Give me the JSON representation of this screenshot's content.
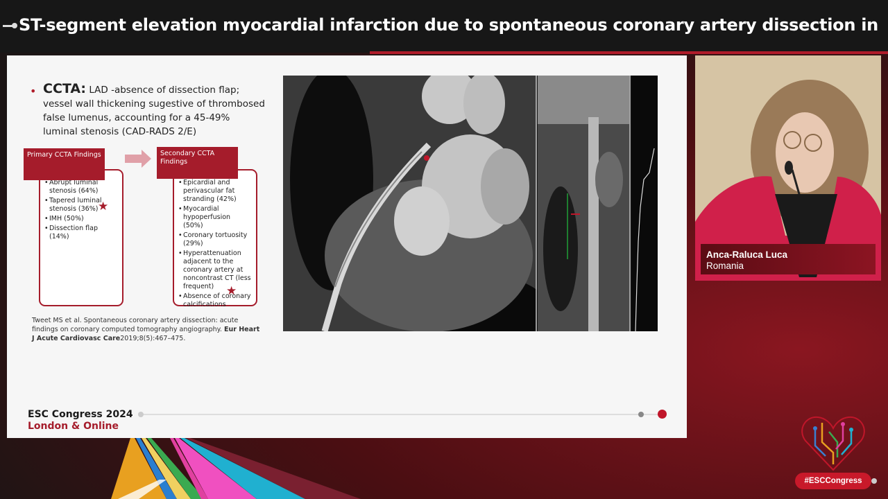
{
  "title": "ST-segment elevation myocardial infarction due to spontaneous coronary artery dissection in a you…",
  "slide": {
    "heading": "CCTA:",
    "body": "LAD -absence of dissection flap; vessel wall thickening  sugestive of thrombosed false lumenus, accounting for a 45-49% luminal stenosis (CAD-RADS 2/E)",
    "primary": {
      "header": "Primary CCTA Findings",
      "items": [
        "Abrupt luminal stenosis (64%)",
        "Tapered luminal stenosis (36%)",
        "IMH (50%)",
        "Dissection flap (14%)"
      ]
    },
    "secondary": {
      "header": "Secondary CCTA Findings",
      "items": [
        "Epicardial and perivascular fat stranding (42%)",
        "Myocardial hypoperfusion (50%)",
        "Coronary tortuosity (29%)",
        "Hyperattenuation adjacent to the coronary artery at noncontrast CT (less frequent)",
        "Absence of coronary calcifications"
      ]
    },
    "citation_plain": "Tweet MS et al.  Spontaneous coronary artery dissection: acute findings on coronary computed tomography angiography. ",
    "citation_journal": "Eur Heart J Acute Cardiovasc Care",
    "citation_tail": "2019;8(5):467–475.",
    "logo_line1": "ESC Congress 2024",
    "logo_line2": "London & Online"
  },
  "speaker": {
    "name": "Anca-Raluca Luca",
    "country": "Romania"
  },
  "hashtag": "#ESCCongress",
  "colors": {
    "brand_red": "#a51c2b",
    "title_bg": "#171717"
  }
}
